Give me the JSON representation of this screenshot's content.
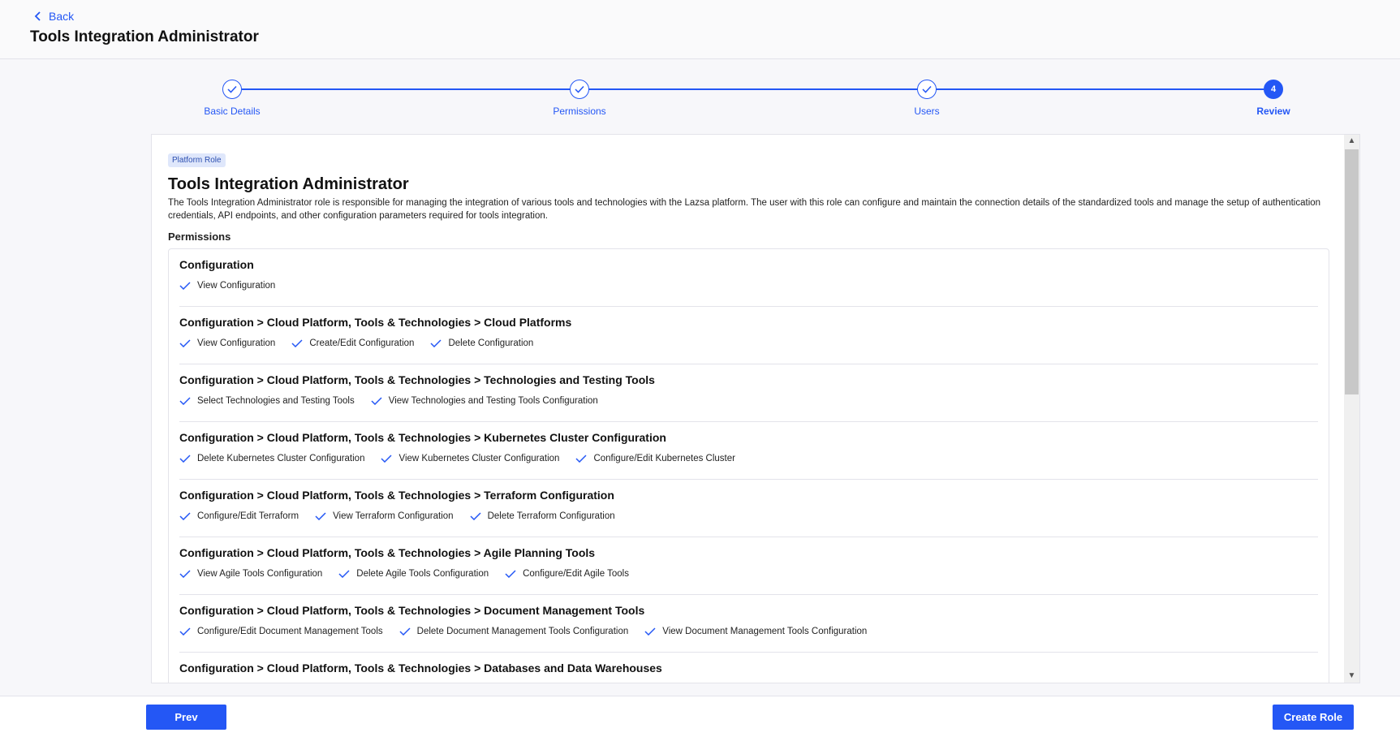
{
  "header": {
    "back_label": "Back",
    "title": "Tools Integration Administrator"
  },
  "stepper": {
    "steps": [
      {
        "label": "Basic Details",
        "state": "completed"
      },
      {
        "label": "Permissions",
        "state": "completed"
      },
      {
        "label": "Users",
        "state": "completed"
      },
      {
        "label": "Review",
        "state": "active",
        "number": "4"
      }
    ]
  },
  "review": {
    "badge": "Platform Role",
    "title": "Tools Integration Administrator",
    "description": "The Tools Integration Administrator role is responsible for managing the integration of various tools and technologies with the Lazsa platform. The user with this role can configure and maintain the connection details of the standardized tools and manage the setup of authentication credentials, API endpoints, and other configuration parameters required for tools integration.",
    "permissions_label": "Permissions",
    "sections": [
      {
        "title": "Configuration",
        "items": [
          "View Configuration"
        ]
      },
      {
        "title": "Configuration > Cloud Platform, Tools & Technologies > Cloud Platforms",
        "items": [
          "View Configuration",
          "Create/Edit Configuration",
          "Delete Configuration"
        ]
      },
      {
        "title": "Configuration > Cloud Platform, Tools & Technologies > Technologies and Testing Tools",
        "items": [
          "Select Technologies and Testing Tools",
          "View Technologies and Testing Tools Configuration"
        ]
      },
      {
        "title": "Configuration > Cloud Platform, Tools & Technologies > Kubernetes Cluster Configuration",
        "items": [
          "Delete Kubernetes Cluster Configuration",
          "View Kubernetes Cluster Configuration",
          "Configure/Edit Kubernetes Cluster"
        ]
      },
      {
        "title": "Configuration > Cloud Platform, Tools & Technologies > Terraform Configuration",
        "items": [
          "Configure/Edit Terraform",
          "View Terraform Configuration",
          "Delete Terraform Configuration"
        ]
      },
      {
        "title": "Configuration > Cloud Platform, Tools & Technologies > Agile Planning Tools",
        "items": [
          "View Agile Tools Configuration",
          "Delete Agile Tools Configuration",
          "Configure/Edit Agile Tools"
        ]
      },
      {
        "title": "Configuration > Cloud Platform, Tools & Technologies > Document Management Tools",
        "items": [
          "Configure/Edit Document Management Tools",
          "Delete Document Management Tools Configuration",
          "View Document Management Tools Configuration"
        ]
      },
      {
        "title": "Configuration > Cloud Platform, Tools & Technologies > Databases and Data Warehouses",
        "items": []
      }
    ]
  },
  "footer": {
    "prev_label": "Prev",
    "create_label": "Create Role"
  },
  "colors": {
    "accent": "#2457f5"
  }
}
